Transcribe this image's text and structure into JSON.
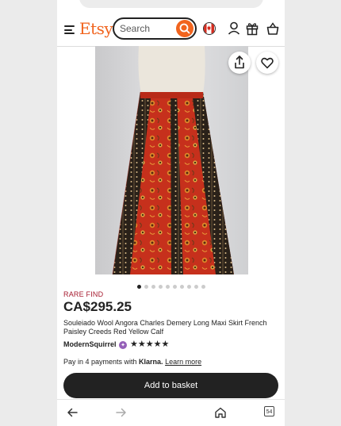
{
  "browser": {
    "close_glyph": "✕"
  },
  "header": {
    "logo": "Etsy",
    "search_placeholder": "Search"
  },
  "gallery": {
    "image_count": 10,
    "active_index": 0
  },
  "product": {
    "badge": "RARE FIND",
    "price": "CA$295.25",
    "title": "Souleiado Wool Angora Charles Demery Long Maxi Skirt French Paisley Creeds Red Yellow Calf",
    "shop_name": "ModernSquirrel",
    "rating": 5,
    "star_glyphs": "★★★★★"
  },
  "payment": {
    "prefix": "Pay in 4 payments with ",
    "provider": "Klarna.",
    "link": "Learn more"
  },
  "cta": {
    "add_to_basket": "Add to basket"
  },
  "browser_nav": {
    "tab_count": "54"
  },
  "colors": {
    "brand": "#f1641e",
    "rare_find": "#a61a2e",
    "button": "#222222"
  }
}
